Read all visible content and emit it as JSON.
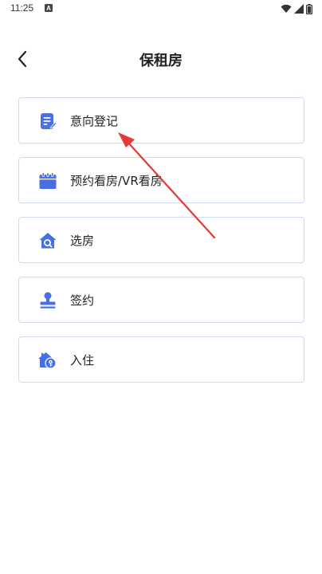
{
  "status_bar": {
    "time": "11:25",
    "icons": [
      "notification-a-icon",
      "wifi-icon",
      "signal-icon",
      "battery-icon"
    ]
  },
  "header": {
    "title": "保租房",
    "back_icon": "chevron-left-icon"
  },
  "menu": {
    "items": [
      {
        "label": "意向登记",
        "icon": "document-edit-icon"
      },
      {
        "label": "预约看房/VR看房",
        "icon": "calendar-icon"
      },
      {
        "label": "选房",
        "icon": "house-search-icon"
      },
      {
        "label": "签约",
        "icon": "stamp-icon"
      },
      {
        "label": "入住",
        "icon": "house-key-icon"
      }
    ]
  },
  "colors": {
    "accent": "#4a6fe3",
    "card_border": "#cfdcef",
    "annotation": "#e53935"
  }
}
